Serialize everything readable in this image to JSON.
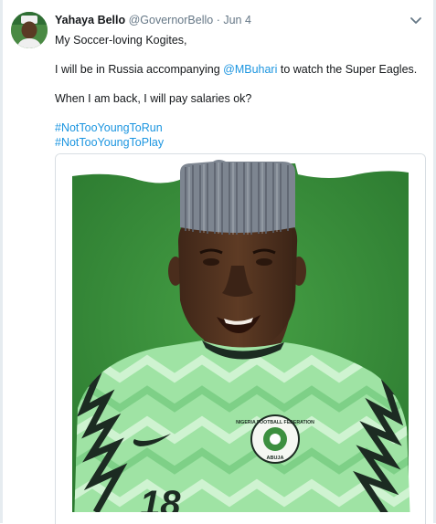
{
  "tweet": {
    "author_name": "Yahaya Bello",
    "author_handle": "@GovernorBello",
    "separator": "·",
    "date": "Jun 4",
    "greeting": "My Soccer-loving Kogites,",
    "line2_prefix": "I will be in Russia accompanying ",
    "line2_mention": "@MBuhari",
    "line2_suffix": " to watch the Super Eagles.",
    "line3": "When I am back, I will pay salaries ok?",
    "hashtags": [
      "#NotTooYoungToRun",
      "#NotTooYoungToPlay"
    ]
  },
  "media": {
    "jersey_number": "18",
    "crest_text": "NIGERIA FOOTBALL FEDERATION",
    "crest_city": "ABUJA"
  },
  "icons": {
    "avatar": "avatar-photo",
    "caret": "chevron-down-icon",
    "brand": "swoosh-logo"
  },
  "colors": {
    "link": "#1b95e0",
    "muted": "#657786",
    "green_bg": "#3b8a39",
    "jersey_green": "#9fe3a4",
    "cap": "#7d8590"
  }
}
